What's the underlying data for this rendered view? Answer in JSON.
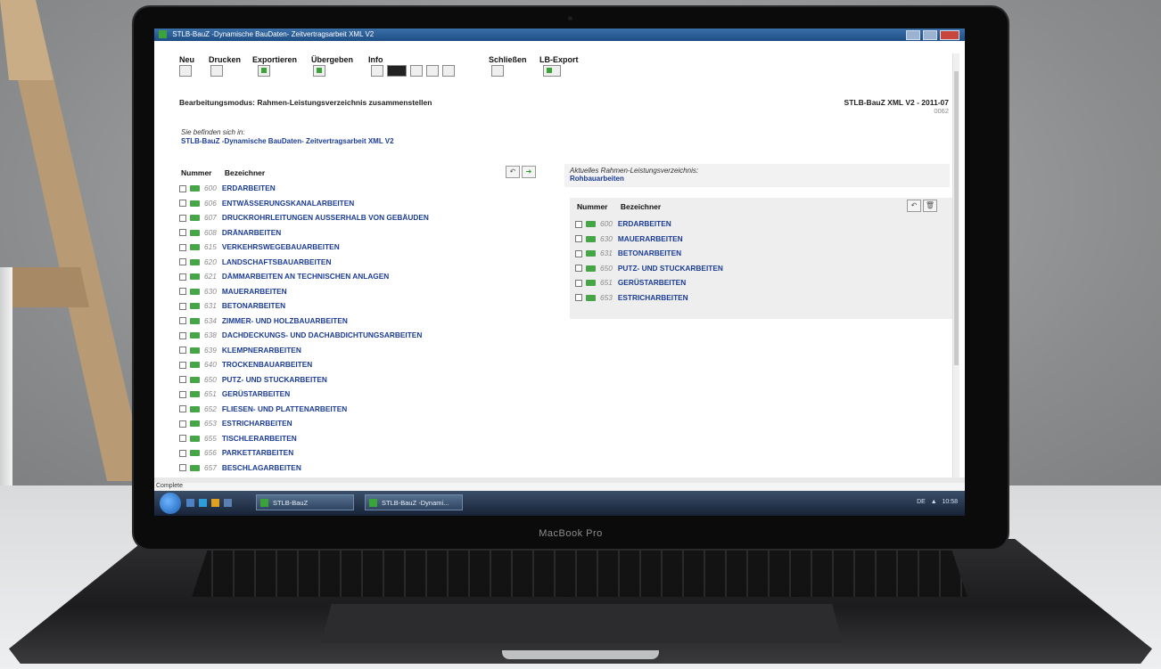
{
  "window": {
    "title": "STLB-BauZ -Dynamische BauDaten- Zeitvertragsarbeit XML V2"
  },
  "toolbar": {
    "items": [
      "Neu",
      "Drucken",
      "Exportieren",
      "Übergeben",
      "Info",
      "Schließen",
      "LB-Export"
    ]
  },
  "mode": {
    "label": "Bearbeitungsmodus: Rahmen-Leistungsverzeichnis zusammenstellen"
  },
  "version": {
    "text": "STLB-BauZ XML V2 - 2011-07",
    "code": "0062"
  },
  "location": {
    "label": "Sie befinden sich in:",
    "value": "STLB-BauZ -Dynamische BauDaten- Zeitvertragsarbeit XML V2"
  },
  "left_panel": {
    "col_number": "Nummer",
    "col_name": "Bezeichner",
    "rows": [
      {
        "num": "600",
        "label": "ERDARBEITEN"
      },
      {
        "num": "606",
        "label": "ENTWÄSSERUNGSKANALARBEITEN"
      },
      {
        "num": "607",
        "label": "DRUCKROHRLEITUNGEN AUSSERHALB VON GEBÄUDEN"
      },
      {
        "num": "608",
        "label": "DRÄNARBEITEN"
      },
      {
        "num": "615",
        "label": "VERKEHRSWEGEBAUARBEITEN"
      },
      {
        "num": "620",
        "label": "LANDSCHAFTSBAUARBEITEN"
      },
      {
        "num": "621",
        "label": "DÄMMARBEITEN AN TECHNISCHEN ANLAGEN"
      },
      {
        "num": "630",
        "label": "MAUERARBEITEN"
      },
      {
        "num": "631",
        "label": "BETONARBEITEN"
      },
      {
        "num": "634",
        "label": "ZIMMER- UND HOLZBAUARBEITEN"
      },
      {
        "num": "638",
        "label": "DACHDECKUNGS- UND DACHABDICHTUNGSARBEITEN"
      },
      {
        "num": "639",
        "label": "KLEMPNERARBEITEN"
      },
      {
        "num": "640",
        "label": "TROCKENBAUARBEITEN"
      },
      {
        "num": "650",
        "label": "PUTZ- UND STUCKARBEITEN"
      },
      {
        "num": "651",
        "label": "GERÜSTARBEITEN"
      },
      {
        "num": "652",
        "label": "FLIESEN- UND PLATTENARBEITEN"
      },
      {
        "num": "653",
        "label": "ESTRICHARBEITEN"
      },
      {
        "num": "655",
        "label": "TISCHLERARBEITEN"
      },
      {
        "num": "656",
        "label": "PARKETTARBEITEN"
      },
      {
        "num": "657",
        "label": "BESCHLAGARBEITEN"
      }
    ]
  },
  "right_panel": {
    "current_label": "Aktuelles Rahmen-Leistungsverzeichnis:",
    "current_value": "Rohbauarbeiten",
    "col_number": "Nummer",
    "col_name": "Bezeichner",
    "rows": [
      {
        "num": "600",
        "label": "ERDARBEITEN"
      },
      {
        "num": "630",
        "label": "MAUERARBEITEN"
      },
      {
        "num": "631",
        "label": "BETONARBEITEN"
      },
      {
        "num": "650",
        "label": "PUTZ- UND STUCKARBEITEN"
      },
      {
        "num": "651",
        "label": "GERÜSTARBEITEN"
      },
      {
        "num": "653",
        "label": "ESTRICHARBEITEN"
      }
    ]
  },
  "statusbar": {
    "text": "Complete"
  },
  "taskbar": {
    "task1": "STLB-BauZ",
    "task2": "STLB-BauZ -Dynami...",
    "clock": "10:58",
    "lang": "DE"
  },
  "device": {
    "brand": "MacBook Pro"
  }
}
